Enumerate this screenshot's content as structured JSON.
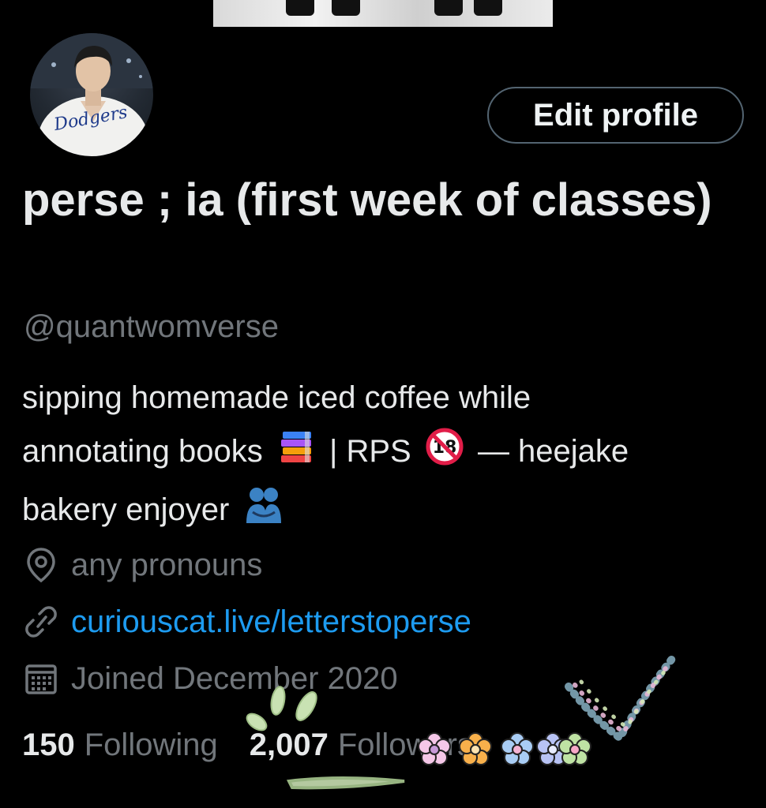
{
  "header": {
    "edit_profile_label": "Edit profile"
  },
  "profile": {
    "display_name": "perse ; ia (first week of classes)",
    "handle": "@quantwomverse",
    "bio": {
      "line1": "sipping homemade iced coffee while",
      "line2_a": "annotating books",
      "line2_b": "| RPS",
      "line2_c": "— heejake",
      "line3_a": "bakery enjoyer",
      "emoji_books": "books-emoji",
      "emoji_no18": "no-one-under-eighteen-emoji",
      "emoji_hug": "people-hugging-emoji",
      "no18_text": "18"
    },
    "avatar_logo_text": "Dodgers",
    "location": "any pronouns",
    "website": "curiouscat.live/letterstoperse",
    "joined": "Joined December 2020",
    "following_count": "150",
    "following_label": "Following",
    "followers_count": "2,007",
    "followers_label": "Followers"
  },
  "colors": {
    "background": "#000000",
    "primary_text": "#e7e9ea",
    "secondary_text": "#71767b",
    "link": "#1d9bf0",
    "button_border": "#536471"
  },
  "icons": [
    "location-pin-icon",
    "link-icon",
    "calendar-icon"
  ]
}
